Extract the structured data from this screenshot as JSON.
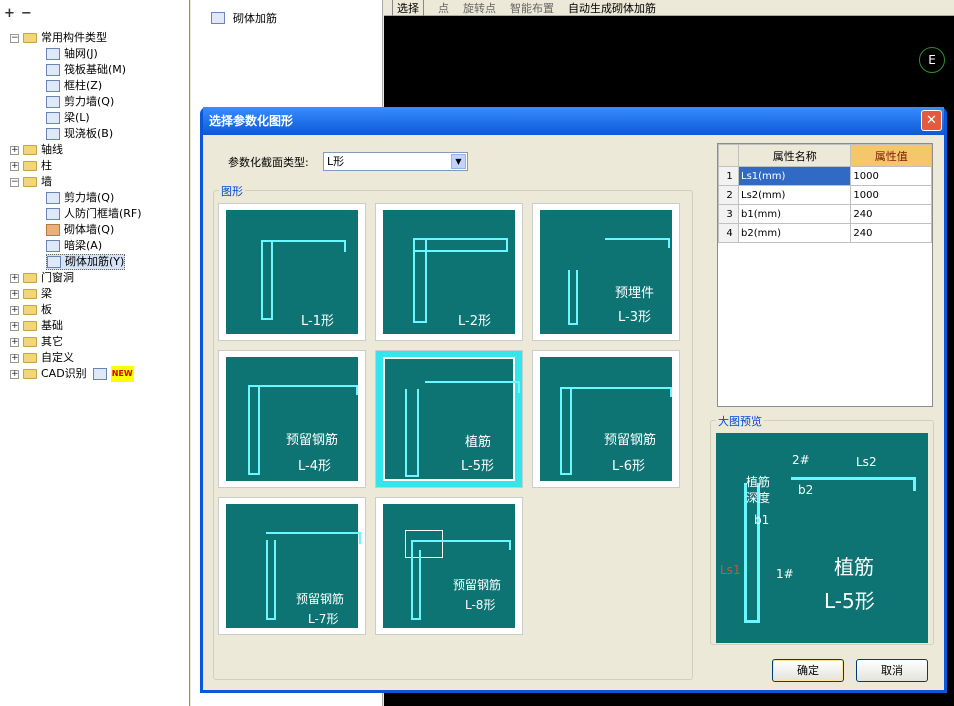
{
  "tree": {
    "root": "常用构件类型",
    "children": [
      "轴网(J)",
      "筏板基础(M)",
      "框柱(Z)",
      "剪力墙(Q)",
      "梁(L)",
      "现浇板(B)"
    ],
    "folders": [
      "轴线",
      "柱",
      "墙"
    ],
    "wall_children": [
      "剪力墙(Q)",
      "人防门框墙(RF)",
      "砌体墙(Q)",
      "暗梁(A)",
      "砌体加筋(Y)"
    ],
    "more_folders": [
      "门窗洞",
      "梁",
      "板",
      "基础",
      "其它",
      "自定义",
      "CAD识别"
    ],
    "new_badge": "NEW"
  },
  "mid": {
    "item": "砌体加筋"
  },
  "topbar": {
    "items": [
      "选择",
      "点",
      "旋转点",
      "智能布置",
      "自动生成砌体加筋"
    ]
  },
  "axis_label": "E",
  "dialog": {
    "title": "选择参数化图形",
    "close_glyph": "✕",
    "type_label": "参数化截面类型:",
    "type_value": "L形",
    "shapes_group": "图形",
    "preview_group": "大图预览",
    "ok": "确定",
    "cancel": "取消"
  },
  "shapes": [
    {
      "name": "L-1形",
      "sub": ""
    },
    {
      "name": "L-2形",
      "sub": ""
    },
    {
      "name": "L-3形",
      "sub": "预埋件"
    },
    {
      "name": "L-4形",
      "sub": "预留钢筋"
    },
    {
      "name": "L-5形",
      "sub": "植筋"
    },
    {
      "name": "L-6形",
      "sub": "预留钢筋"
    },
    {
      "name": "L-7形",
      "sub": "预留钢筋"
    },
    {
      "name": "L-8形",
      "sub": "预留钢筋"
    }
  ],
  "props": {
    "headers": [
      "属性名称",
      "属性值"
    ],
    "rows": [
      {
        "idx": "1",
        "name": "Ls1(mm)",
        "value": "1000"
      },
      {
        "idx": "2",
        "name": "Ls2(mm)",
        "value": "1000"
      },
      {
        "idx": "3",
        "name": "b1(mm)",
        "value": "240"
      },
      {
        "idx": "4",
        "name": "b2(mm)",
        "value": "240"
      }
    ]
  },
  "preview": {
    "title": "植筋",
    "name": "L-5形",
    "labels": [
      "植筋",
      "深度",
      "Ls2",
      "Ls1",
      "b1",
      "b2",
      "1#",
      "2#"
    ]
  }
}
